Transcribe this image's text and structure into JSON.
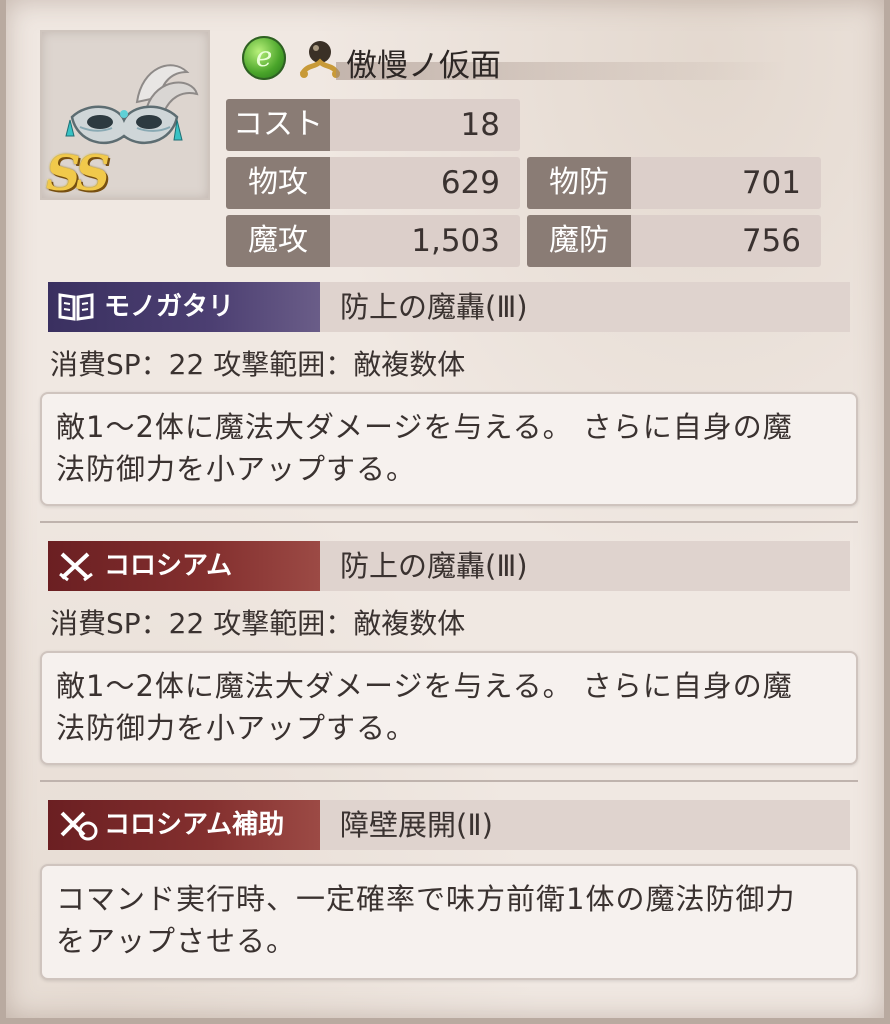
{
  "item": {
    "name": "傲慢ノ仮面",
    "rank": "SS",
    "element_icon": "wind-element-icon",
    "type_icon": "accessory-type-icon",
    "element_letter": "e"
  },
  "stats": {
    "cost": {
      "label": "コスト",
      "value": "18"
    },
    "phys_atk": {
      "label": "物攻",
      "value": "629"
    },
    "phys_def": {
      "label": "物防",
      "value": "701"
    },
    "mag_atk": {
      "label": "魔攻",
      "value": "1,503"
    },
    "mag_def": {
      "label": "魔防",
      "value": "756"
    }
  },
  "skills": [
    {
      "tag": "モノガタリ",
      "tag_icon": "book-icon",
      "name": "防上の魔轟(Ⅲ)",
      "sp": "消費SP：22 攻撃範囲：敵複数体",
      "desc_line1": "敵1～2体に魔法大ダメージを与える。 さらに自身の魔",
      "desc_line2": "法防御力を小アップする。"
    },
    {
      "tag": "コロシアム",
      "tag_icon": "crossed-swords-icon",
      "name": "防上の魔轟(Ⅲ)",
      "sp": "消費SP：22 攻撃範囲：敵複数体",
      "desc_line1": "敵1～2体に魔法大ダメージを与える。 さらに自身の魔",
      "desc_line2": "法防御力を小アップする。"
    },
    {
      "tag": "コロシアム補助",
      "tag_icon": "crossed-swords-support-icon",
      "name": "障壁展開(Ⅱ)",
      "desc_line1": "コマンド実行時、一定確率で味方前衛1体の魔法防御力",
      "desc_line2": "をアップさせる。"
    }
  ],
  "colors": {
    "label_bg": "#8a7c75",
    "monogatari_tag": "#4c3f72",
    "colosseum_tag": "#84302f"
  }
}
